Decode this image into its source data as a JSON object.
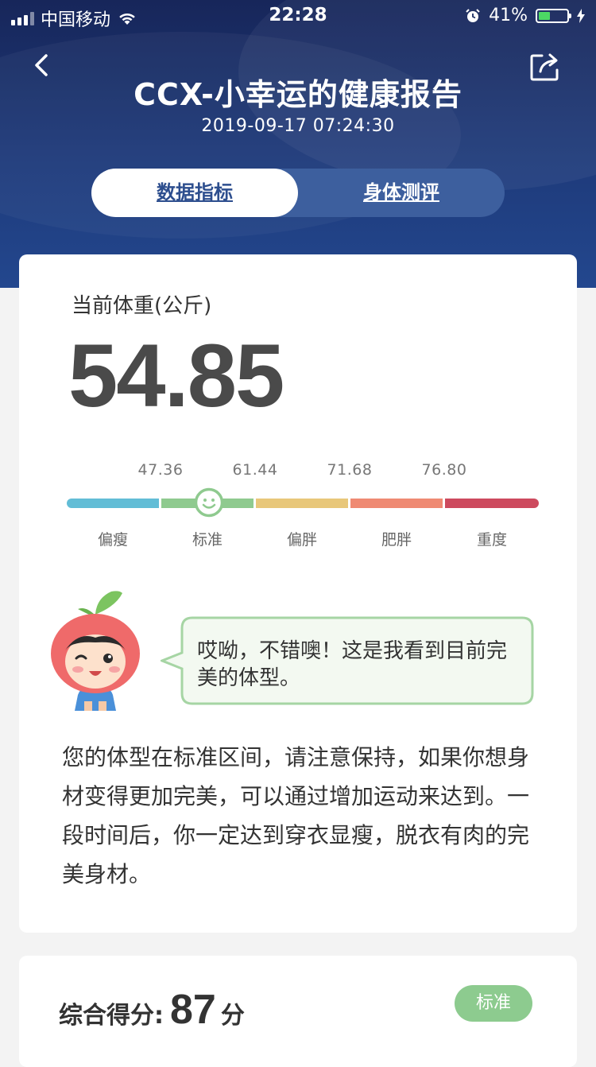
{
  "status_bar": {
    "carrier": "中国移动",
    "time": "22:28",
    "battery_percent": "41%",
    "battery_level": 0.41,
    "battery_color": "#4cd964"
  },
  "header": {
    "title": "CCX-小幸运的健康报告",
    "datetime": "2019-09-17 07:24:30",
    "back_icon": "chevron-left-icon",
    "share_icon": "share-icon",
    "tabs": [
      {
        "label": "数据指标",
        "active": true
      },
      {
        "label": "身体测评",
        "active": false
      }
    ]
  },
  "weight": {
    "label": "当前体重(公斤)",
    "value": "54.85",
    "thresholds": [
      "47.36",
      "61.44",
      "71.68",
      "76.80"
    ],
    "categories": [
      {
        "label": "偏瘦",
        "color": "#62bdd6"
      },
      {
        "label": "标准",
        "color": "#8fca8f"
      },
      {
        "label": "偏胖",
        "color": "#e8c77a"
      },
      {
        "label": "肥胖",
        "color": "#ef8a73"
      },
      {
        "label": "重度",
        "color": "#cd4a5e"
      }
    ],
    "current_category": "标准",
    "marker_position_in_category": 0.5
  },
  "mascot": {
    "icon": "tomato-mascot-icon",
    "speech": "哎呦，不错噢！这是我看到目前完美的体型。"
  },
  "description": "您的体型在标准区间，请注意保持，如果你想身材变得更加完美，可以通过增加运动来达到。一段时间后，你一定达到穿衣显瘦，脱衣有肉的完美身材。",
  "score": {
    "label": "综合得分:",
    "value": "87",
    "unit": "分",
    "badge": "标准",
    "badge_color": "#8dcb8f"
  }
}
